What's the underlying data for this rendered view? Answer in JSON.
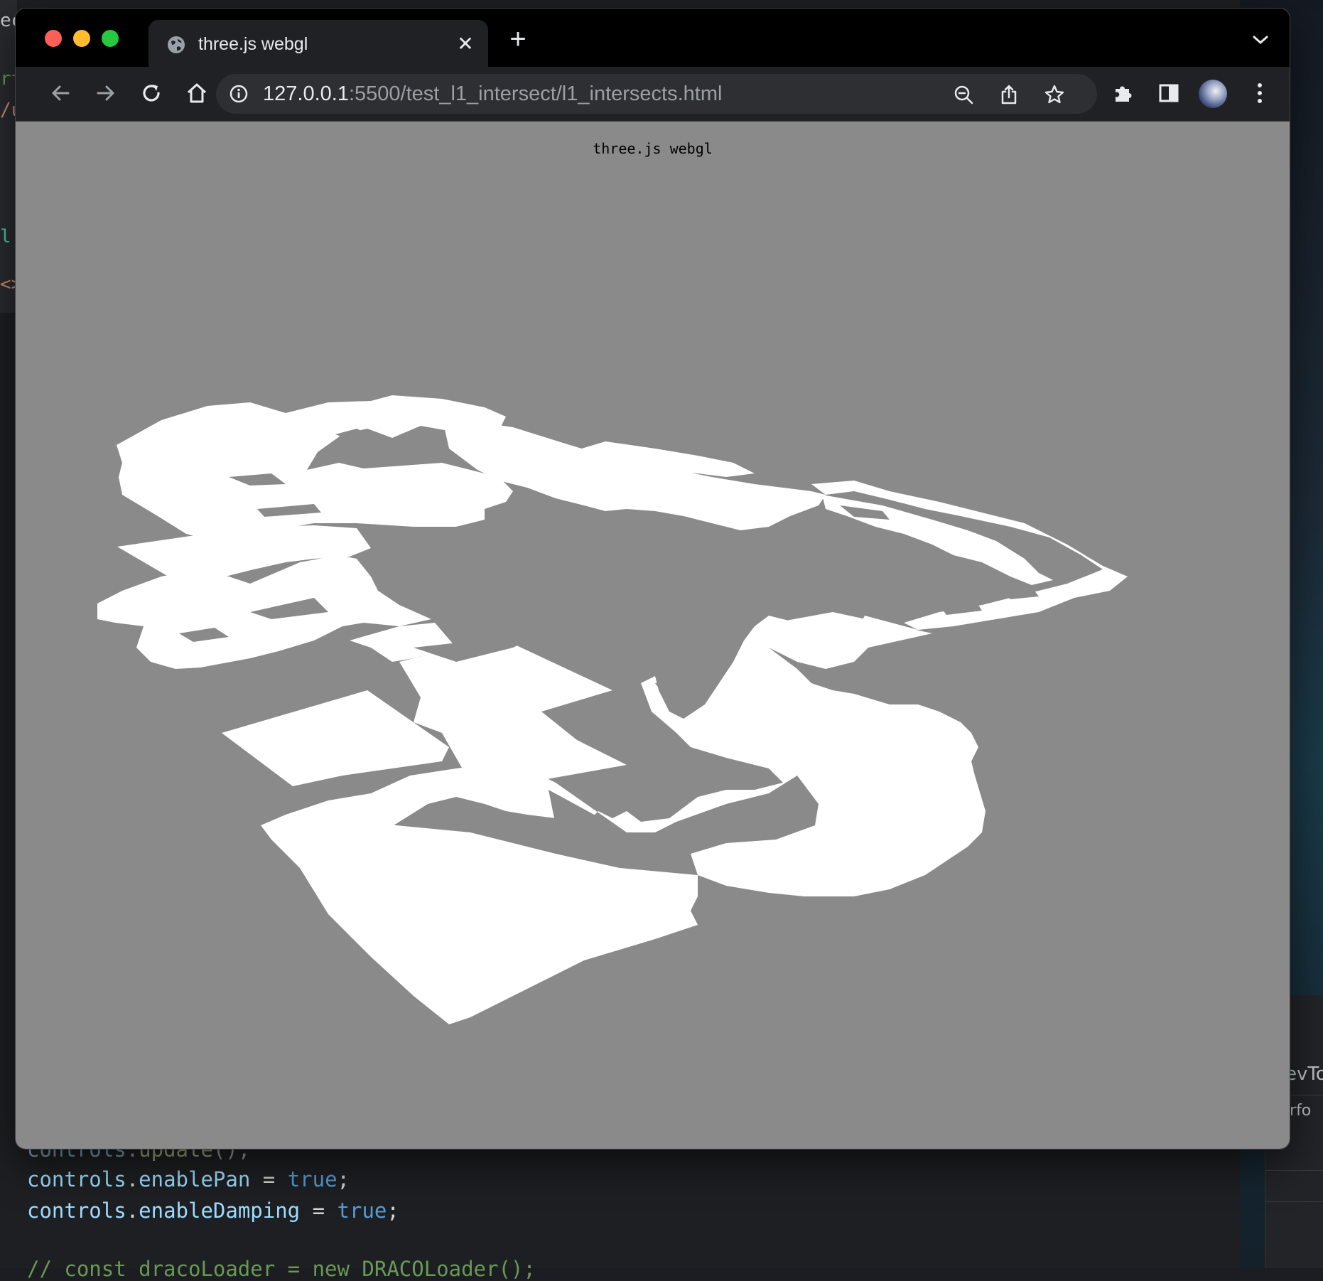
{
  "background": {
    "code_lines": [
      {
        "obj": "controls",
        "dot": ".",
        "prop": "update",
        "rest": "();"
      },
      {
        "obj": "controls",
        "dot": ".",
        "prop": "enablePan",
        "eq": " = ",
        "val": "true",
        "end": ";"
      },
      {
        "obj": "controls",
        "dot": ".",
        "prop": "enableDamping",
        "eq": " = ",
        "val": "true",
        "end": ";"
      },
      {
        "comment": "// const dracoLoader = new DRACOLoader();"
      }
    ],
    "devtools_tab": "DevTo",
    "devtools_subtab": "Perfo",
    "left_fragments": [
      "ec",
      "rt",
      "/u",
      "l u",
      "<>"
    ]
  },
  "browser": {
    "tab": {
      "title": "three.js webgl",
      "close_symbol": "✕"
    },
    "new_tab_symbol": "+",
    "address_bar": {
      "host": "127.0.0.1",
      "rest": ":5500/test_l1_intersect/l1_intersects.html"
    },
    "icons": {
      "back": "arrow-left-icon",
      "forward": "arrow-right-icon",
      "reload": "reload-icon",
      "home": "home-icon",
      "site_info": "info-icon",
      "zoom": "zoom-out-icon",
      "share": "share-icon",
      "bookmark": "star-icon",
      "extensions": "puzzle-icon",
      "side_panel": "side-panel-icon",
      "menu": "kebab-menu-icon"
    }
  },
  "page": {
    "info_text": "three.js webgl",
    "background_color": "#8a8a8a",
    "mesh_color": "#ffffff"
  }
}
